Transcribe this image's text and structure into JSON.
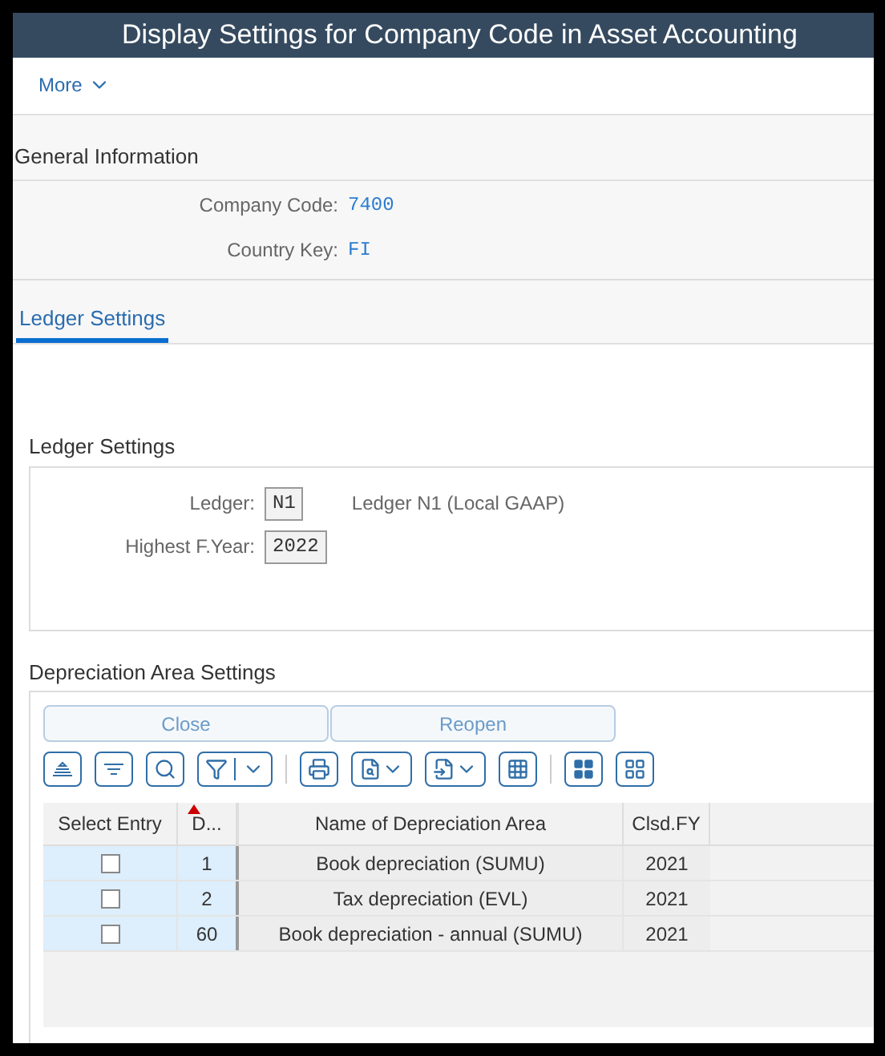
{
  "window": {
    "title": "Display Settings for Company Code in Asset Accounting"
  },
  "toolbar": {
    "more": "More"
  },
  "general_information": {
    "heading": "General Information",
    "fields": [
      {
        "label": "Company Code:",
        "value": "7400"
      },
      {
        "label": "Country Key:",
        "value": "FI"
      }
    ]
  },
  "tabs": [
    {
      "label": "Ledger Settings",
      "selected": true
    }
  ],
  "ledger_settings": {
    "heading": "Ledger Settings",
    "fields": [
      {
        "label": "Ledger:",
        "value": "N1",
        "description": "Ledger N1 (Local GAAP)"
      },
      {
        "label": "Highest F.Year:",
        "value": "2022"
      }
    ]
  },
  "depreciation_area_settings": {
    "heading": "Depreciation Area Settings",
    "buttons": [
      "Close",
      "Reopen"
    ],
    "table": {
      "columns": [
        {
          "label": "Select Entry"
        },
        {
          "label": "D...",
          "sorted": true
        },
        {
          "label": "Name of Depreciation Area"
        },
        {
          "label": "Clsd.FY"
        }
      ],
      "rows": [
        {
          "checked": false,
          "area": "1",
          "name": "Book depreciation (SUMU)",
          "closed_fy": "2021"
        },
        {
          "checked": false,
          "area": "2",
          "name": "Tax depreciation (EVL)",
          "closed_fy": "2021"
        },
        {
          "checked": false,
          "area": "60",
          "name": "Book depreciation - annual (SUMU)",
          "closed_fy": "2021"
        }
      ]
    }
  }
}
